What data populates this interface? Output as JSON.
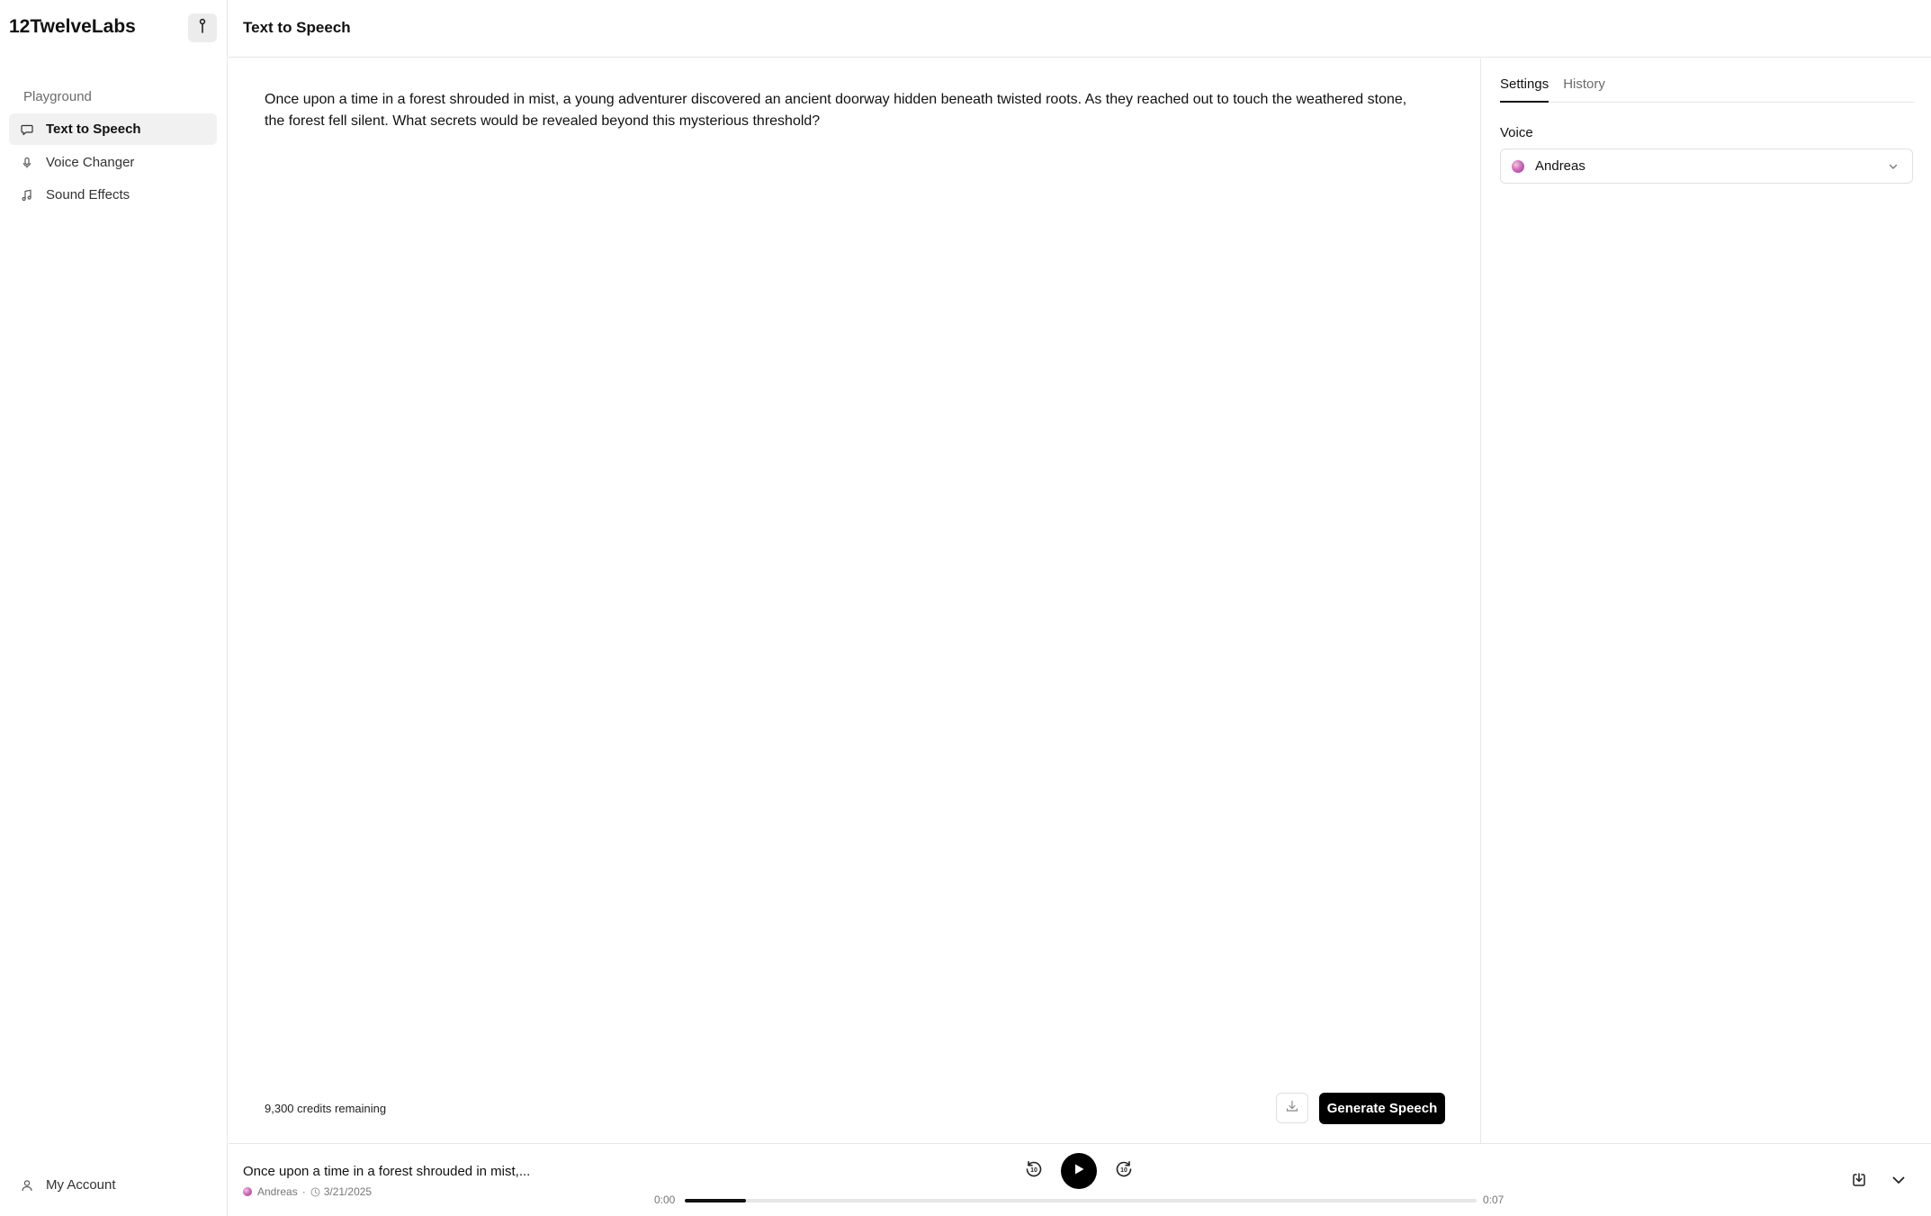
{
  "app": {
    "brand": "12TwelveLabs"
  },
  "sidebar": {
    "group_label": "Playground",
    "items": [
      {
        "label": "Text to Speech",
        "icon": "message-icon",
        "active": true
      },
      {
        "label": "Voice Changer",
        "icon": "microphone-icon",
        "active": false
      },
      {
        "label": "Sound Effects",
        "icon": "music-note-icon",
        "active": false
      }
    ],
    "account_label": "My Account"
  },
  "header": {
    "title": "Text to Speech"
  },
  "editor": {
    "text": "Once upon a time in a forest shrouded in mist, a young adventurer discovered an ancient doorway hidden beneath twisted roots. As they reached out to touch the weathered stone, the forest fell silent. What secrets would be revealed beyond this mysterious threshold?",
    "credits": "9,300 credits remaining",
    "generate_label": "Generate Speech"
  },
  "settings": {
    "tabs": [
      "Settings",
      "History"
    ],
    "active_tab": "Settings",
    "voice_label": "Voice",
    "voice_value": "Andreas"
  },
  "player": {
    "title": "Once upon a time in a forest shrouded in mist,...",
    "voice": "Andreas",
    "separator": "·",
    "date": "3/21/2025",
    "time_current": "0:00",
    "time_total": "0:07",
    "progress": 0.077
  },
  "colors": {
    "accent": "#000000",
    "active_nav_bg": "#f1f1f1",
    "border": "#e6e6e6"
  }
}
